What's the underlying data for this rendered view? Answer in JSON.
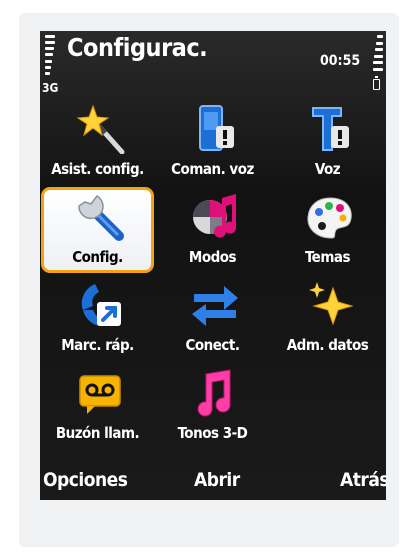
{
  "status_bar": {
    "title": "Configurac.",
    "network": "3G",
    "time": "00:55"
  },
  "menu": {
    "items": [
      {
        "label": "Asist. config.",
        "icon": "wizard-wand-icon"
      },
      {
        "label": "Coman. voz",
        "icon": "voice-commands-icon"
      },
      {
        "label": "Voz",
        "icon": "voice-icon"
      },
      {
        "label": "Config.",
        "icon": "wrench-icon",
        "selected": true
      },
      {
        "label": "Modos",
        "icon": "profiles-icon"
      },
      {
        "label": "Temas",
        "icon": "themes-palette-icon"
      },
      {
        "label": "Marc. ráp.",
        "icon": "speed-dial-icon"
      },
      {
        "label": "Conect.",
        "icon": "connectivity-arrows-icon"
      },
      {
        "label": "Adm. datos",
        "icon": "data-manager-icon"
      },
      {
        "label": "Buzón llam.",
        "icon": "voicemail-icon"
      },
      {
        "label": "Tonos 3-D",
        "icon": "tones-3d-icon"
      }
    ]
  },
  "softkeys": {
    "left": "Opciones",
    "center": "Abrir",
    "right": "Atrás"
  },
  "colors": {
    "selection_border": "#f3a312",
    "screen_background": "#151515"
  }
}
